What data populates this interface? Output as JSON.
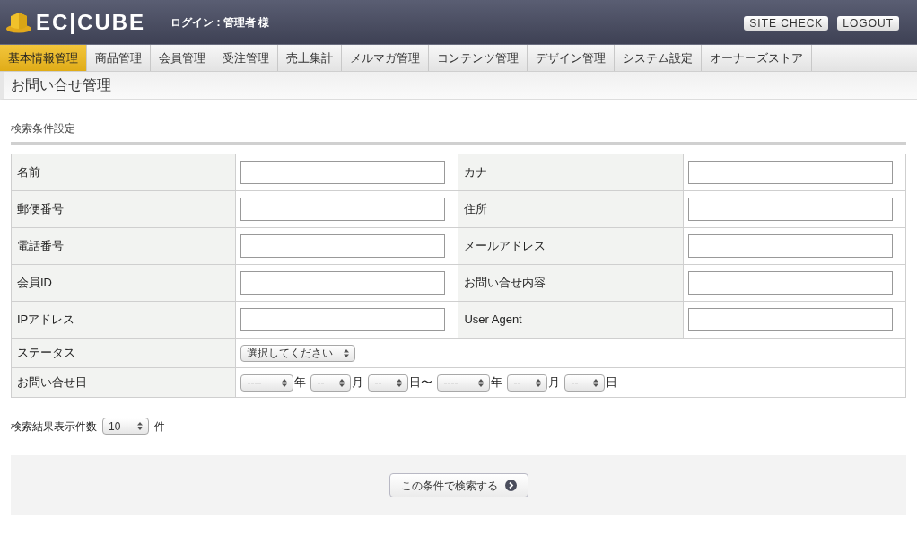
{
  "header": {
    "logo": "EC|CUBE",
    "login": "ログイン : 管理者 様",
    "buttons": [
      "SITE CHECK",
      "LOGOUT"
    ]
  },
  "nav": [
    {
      "label": "基本情報管理",
      "selected": true
    },
    {
      "label": "商品管理",
      "selected": false
    },
    {
      "label": "会員管理",
      "selected": false
    },
    {
      "label": "受注管理",
      "selected": false
    },
    {
      "label": "売上集計",
      "selected": false
    },
    {
      "label": "メルマガ管理",
      "selected": false
    },
    {
      "label": "コンテンツ管理",
      "selected": false
    },
    {
      "label": "デザイン管理",
      "selected": false
    },
    {
      "label": "システム設定",
      "selected": false
    },
    {
      "label": "オーナーズストア",
      "selected": false
    }
  ],
  "page_title": "お問い合せ管理",
  "section_title": "検索条件設定",
  "form_rows": [
    [
      {
        "label": "名前"
      },
      {
        "label": "カナ"
      }
    ],
    [
      {
        "label": "郵便番号"
      },
      {
        "label": "住所"
      }
    ],
    [
      {
        "label": "電話番号"
      },
      {
        "label": "メールアドレス"
      }
    ],
    [
      {
        "label": "会員ID"
      },
      {
        "label": "お問い合せ内容"
      }
    ],
    [
      {
        "label": "IPアドレス"
      },
      {
        "label": "User Agent"
      }
    ]
  ],
  "status": {
    "label": "ステータス",
    "value": "選択してください"
  },
  "date": {
    "label": "お問い合せ日",
    "selects": [
      {
        "value": "----",
        "suffix": "年"
      },
      {
        "value": "--",
        "suffix": "月"
      },
      {
        "value": "--",
        "suffix": "日〜"
      },
      {
        "value": "----",
        "suffix": "年"
      },
      {
        "value": "--",
        "suffix": "月"
      },
      {
        "value": "--",
        "suffix": "日"
      }
    ]
  },
  "results_count": {
    "label": "検索結果表示件数",
    "value": "10",
    "suffix": "件"
  },
  "search_button": "この条件で検索する"
}
